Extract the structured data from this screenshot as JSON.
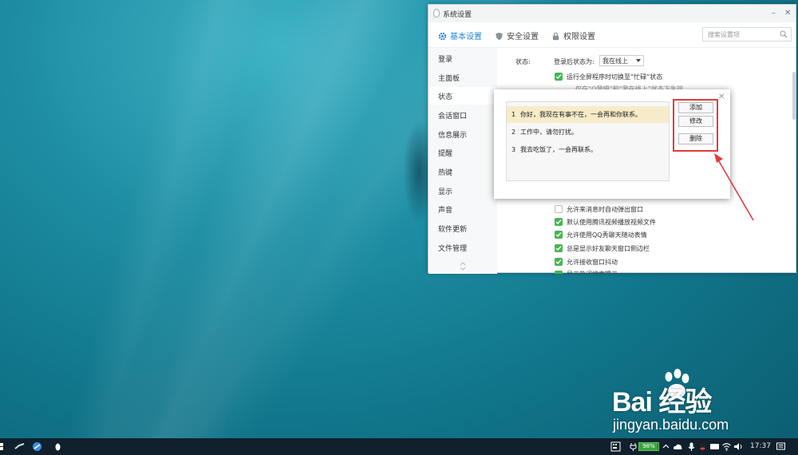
{
  "window": {
    "title": "系统设置",
    "min": "–",
    "close": "✕"
  },
  "tabs": [
    {
      "label": "基本设置",
      "active": true
    },
    {
      "label": "安全设置"
    },
    {
      "label": "权限设置"
    }
  ],
  "search": {
    "placeholder": "搜索设置项"
  },
  "sidebar": {
    "items": [
      {
        "label": "登录"
      },
      {
        "label": "主面板"
      },
      {
        "label": "状态",
        "active": true
      },
      {
        "label": "会话窗口"
      },
      {
        "label": "信息展示"
      },
      {
        "label": "提醒"
      },
      {
        "label": "热键"
      },
      {
        "label": "显示"
      },
      {
        "label": "声音"
      },
      {
        "label": "软件更新"
      },
      {
        "label": "文件管理"
      }
    ]
  },
  "status": {
    "section_label": "状态:",
    "login_status_label": "登录后状态为:",
    "login_status_value": "我在线上",
    "fullscreen_busy": "运行全屏程序时切换至“忙碌”状态",
    "note": "仅在“Q我吧”和“我在线上”状态下生效。",
    "options": [
      {
        "label": "允许来消息时自动弹出窗口",
        "checked": false
      },
      {
        "label": "默认使用腾讯视频播放视频文件",
        "checked": true
      },
      {
        "label": "允许使用QQ秀聊天随动表情",
        "checked": true
      },
      {
        "label": "总是显示好友聊天窗口侧边栏",
        "checked": true
      },
      {
        "label": "允许接收窗口抖动",
        "checked": true
      },
      {
        "label": "显示热词搜索提示",
        "checked": true
      }
    ]
  },
  "dialog": {
    "close": "✕",
    "messages": [
      {
        "num": "1",
        "text": "你好，我现在有事不在，一会再和你联系。"
      },
      {
        "num": "2",
        "text": "工作中，请勿打扰。"
      },
      {
        "num": "3",
        "text": "我去吃饭了，一会再联系。"
      }
    ],
    "add_label": "添加",
    "edit_label": "修改",
    "delete_label": "删除"
  },
  "watermark": {
    "logo": "Bai  经验",
    "url": "jingyan.baidu.com"
  },
  "taskbar": {
    "battery": "98%",
    "time": "17:37"
  },
  "colors": {
    "accent": "#1f86d8",
    "check": "#43b64f",
    "highlight": "#f6ecc9",
    "annotation": "#e23b3b"
  }
}
